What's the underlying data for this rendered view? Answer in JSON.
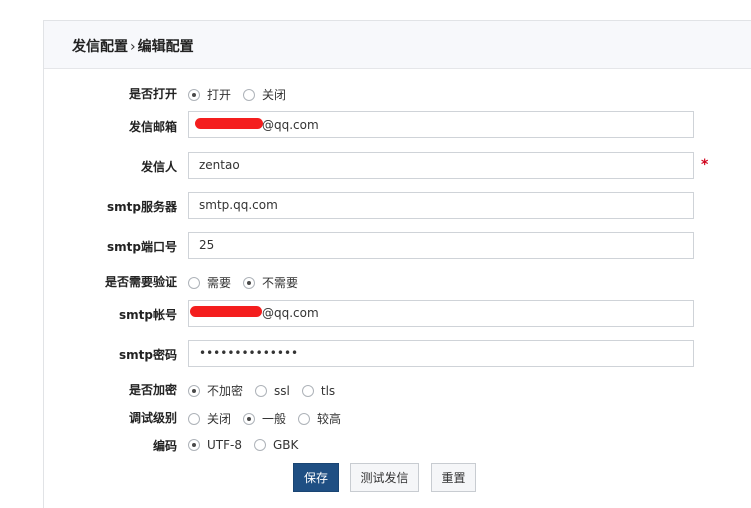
{
  "breadcrumb": {
    "main": "发信配置",
    "separator": "›",
    "sub": "编辑配置"
  },
  "form": {
    "turn_on": {
      "label": "是否打开",
      "options": [
        "打开",
        "关闭"
      ],
      "selected": "打开"
    },
    "sender_email": {
      "label": "发信邮箱",
      "value_visible": "@qq.com"
    },
    "sender_name": {
      "label": "发信人",
      "value": "zentao",
      "required_mark": "*"
    },
    "smtp_server": {
      "label": "smtp服务器",
      "value": "smtp.qq.com"
    },
    "smtp_port": {
      "label": "smtp端口号",
      "value": "25"
    },
    "need_auth": {
      "label": "是否需要验证",
      "options": [
        "需要",
        "不需要"
      ],
      "selected": "不需要"
    },
    "smtp_account": {
      "label": "smtp帐号",
      "value_visible": "@qq.com"
    },
    "smtp_password": {
      "label": "smtp密码",
      "value": "••••••••••••••"
    },
    "encryption": {
      "label": "是否加密",
      "options": [
        "不加密",
        "ssl",
        "tls"
      ],
      "selected": "不加密"
    },
    "debug_level": {
      "label": "调试级别",
      "options": [
        "关闭",
        "一般",
        "较高"
      ],
      "selected": "一般"
    },
    "charset": {
      "label": "编码",
      "options": [
        "UTF-8",
        "GBK"
      ],
      "selected": "UTF-8"
    }
  },
  "buttons": {
    "save": "保存",
    "test": "测试发信",
    "reset": "重置"
  },
  "colors": {
    "primary": "#1f4f83",
    "required": "#d0021b",
    "redaction": "#f41e1e"
  }
}
